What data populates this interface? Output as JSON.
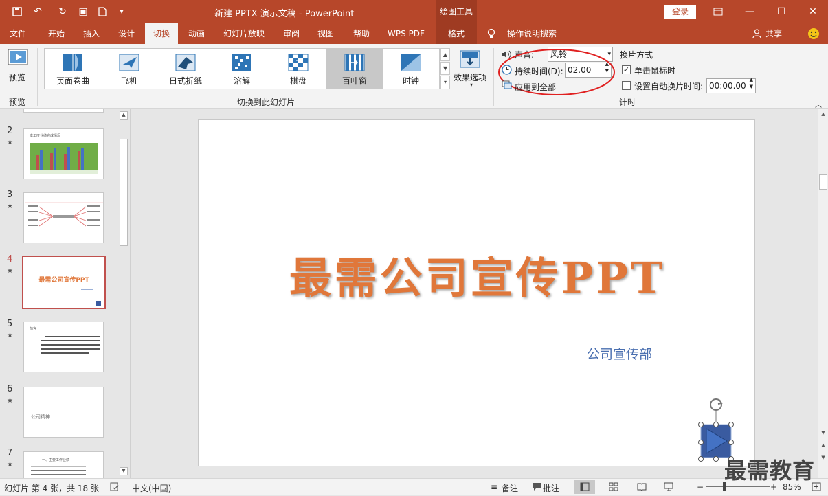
{
  "titlebar": {
    "title": "新建 PPTX 演示文稿  -  PowerPoint",
    "context_tools": "绘图工具",
    "login": "登录",
    "qat": [
      "save-icon",
      "undo-icon",
      "redo-icon",
      "present-icon",
      "new-icon",
      "customize-icon"
    ]
  },
  "tabs": [
    {
      "label": "文件"
    },
    {
      "label": "开始"
    },
    {
      "label": "插入"
    },
    {
      "label": "设计"
    },
    {
      "label": "切换"
    },
    {
      "label": "动画"
    },
    {
      "label": "幻灯片放映"
    },
    {
      "label": "审阅"
    },
    {
      "label": "视图"
    },
    {
      "label": "帮助"
    },
    {
      "label": "WPS PDF"
    },
    {
      "label": "格式"
    }
  ],
  "tellme": "操作说明搜索",
  "share": "共享",
  "ribbon": {
    "preview_label": "预览",
    "preview_group": "预览",
    "gallery": [
      {
        "label": "页面卷曲"
      },
      {
        "label": "飞机"
      },
      {
        "label": "日式折纸"
      },
      {
        "label": "溶解"
      },
      {
        "label": "棋盘"
      },
      {
        "label": "百叶窗"
      },
      {
        "label": "时钟"
      }
    ],
    "effect_options": "效果选项",
    "transition_group": "切换到此幻灯片",
    "sound_label": "声音:",
    "sound_value": "风铃",
    "duration_label": "持续时间(D):",
    "duration_value": "02.00",
    "apply_all": "应用到全部",
    "advance_label": "换片方式",
    "on_click": "单击鼠标时",
    "after_label": "设置自动换片时间:",
    "after_value": "00:00.00",
    "timing_group": "计时"
  },
  "slides": [
    {
      "num": "2",
      "title": "本年度业绩完成情况"
    },
    {
      "num": "3",
      "title": ""
    },
    {
      "num": "4",
      "title": "最需公司宣传PPT"
    },
    {
      "num": "5",
      "title": "前言"
    },
    {
      "num": "6",
      "title": "公司精神"
    },
    {
      "num": "7",
      "title": "一、主要工作业绩"
    }
  ],
  "slide": {
    "title": "最需公司宣传PPT",
    "subtitle": "公司宣传部"
  },
  "status": {
    "slide_info": "幻灯片 第 4 张，共 18 张",
    "language": "中文(中国)",
    "notes": "备注",
    "comments": "批注",
    "zoom": "85%"
  },
  "watermark": "最需教育",
  "colors": {
    "accent": "#b7472a",
    "title": "#e0773a",
    "subtitle": "#4a6fb0"
  }
}
